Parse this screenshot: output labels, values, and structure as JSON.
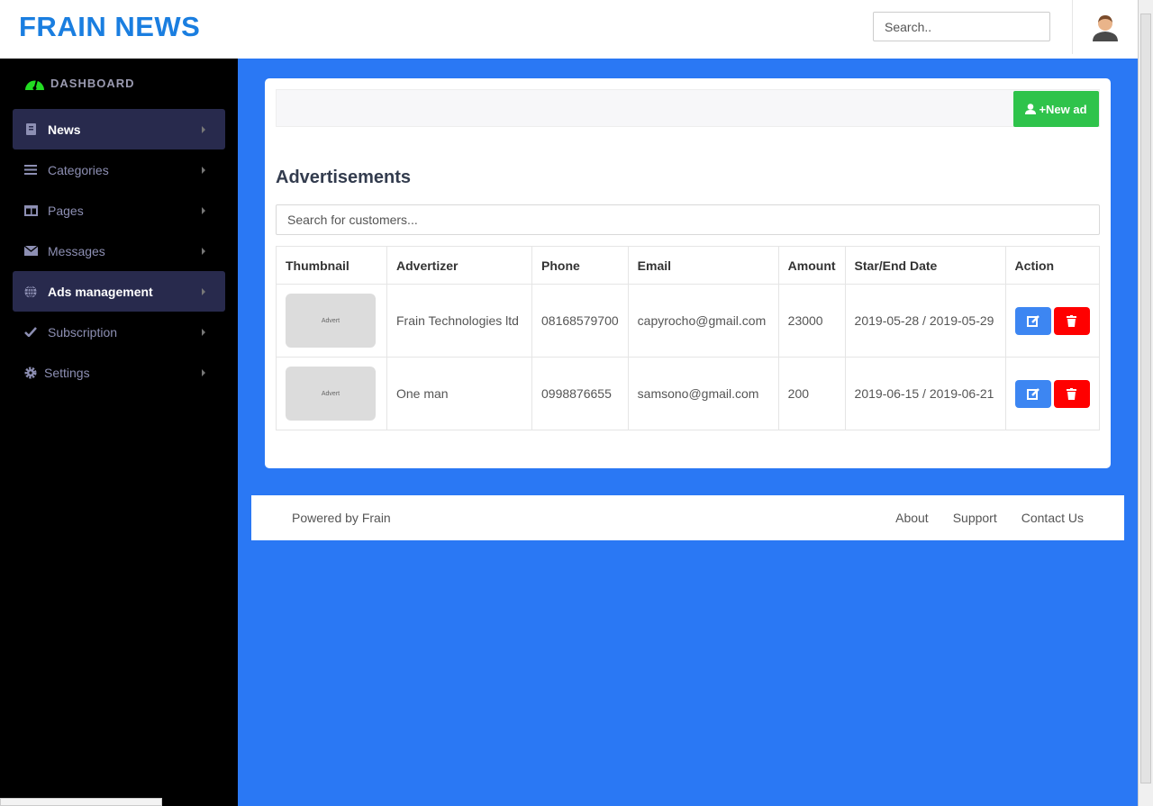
{
  "header": {
    "logo": "FRAIN NEWS",
    "search_placeholder": "Search.."
  },
  "sidebar": {
    "dashboard": "DASHBOARD",
    "items": [
      {
        "label": "News",
        "icon": "book-icon",
        "active": true
      },
      {
        "label": "Categories",
        "icon": "list-icon",
        "active": false
      },
      {
        "label": "Pages",
        "icon": "columns-icon",
        "active": false
      },
      {
        "label": "Messages",
        "icon": "envelope-icon",
        "active": false
      },
      {
        "label": "Ads management",
        "icon": "globe-icon",
        "active": true
      },
      {
        "label": "Subscription",
        "icon": "check-icon",
        "active": false
      },
      {
        "label": "Settings",
        "icon": "gear-icon",
        "active": false
      }
    ]
  },
  "main": {
    "new_ad": "+New ad",
    "title": "Advertisements",
    "search_placeholder": "Search for customers...",
    "columns": [
      "Thumbnail",
      "Advertizer",
      "Phone",
      "Email",
      "Amount",
      "Star/End Date",
      "Action"
    ],
    "rows": [
      {
        "thumb": "Advert",
        "advertizer": "Frain Technologies ltd",
        "phone": "08168579700",
        "email": "capyrocho@gmail.com",
        "amount": "23000",
        "dates": "2019-05-28 / 2019-05-29"
      },
      {
        "thumb": "Advert",
        "advertizer": "One man",
        "phone": "0998876655",
        "email": "samsono@gmail.com",
        "amount": "200",
        "dates": "2019-06-15 / 2019-06-21"
      }
    ]
  },
  "footer": {
    "powered": "Powered by Frain",
    "links": [
      "About",
      "Support",
      "Contact Us"
    ]
  },
  "colors": {
    "brand": "#1a7ee0",
    "bg": "#2a78f4",
    "new": "#2fc34b",
    "edit": "#3d86f2",
    "delete": "#ff0000"
  }
}
